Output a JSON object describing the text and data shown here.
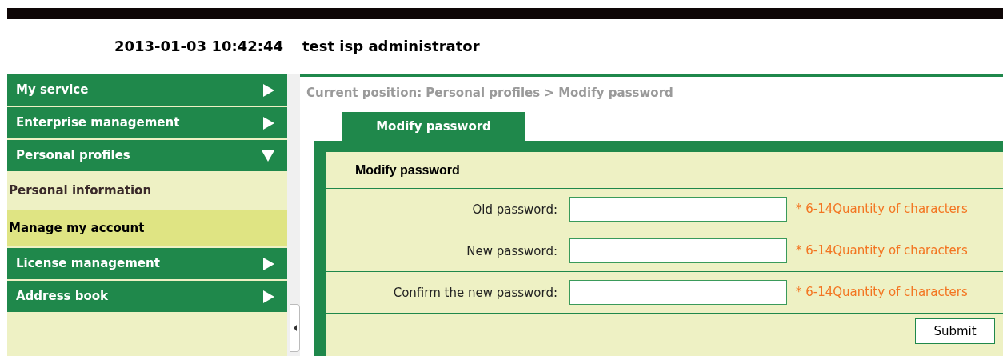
{
  "header": {
    "datetime": "2013-01-03 10:42:44",
    "user": "test isp administrator"
  },
  "sidebar": {
    "items": [
      {
        "label": "My service",
        "expanded": false
      },
      {
        "label": "Enterprise management",
        "expanded": false
      },
      {
        "label": "Personal profiles",
        "expanded": true,
        "children": [
          {
            "label": "Personal information",
            "selected": false
          },
          {
            "label": "Manage my account",
            "selected": true
          }
        ]
      },
      {
        "label": "License management",
        "expanded": false
      },
      {
        "label": "Address book",
        "expanded": false
      }
    ]
  },
  "breadcrumb": "Current position: Personal profiles > Modify password",
  "tabs": [
    {
      "label": "Modify password",
      "selected": true
    }
  ],
  "form": {
    "title": "Modify password",
    "fields": [
      {
        "label": "Old password:",
        "hint": "* 6-14Quantity of characters"
      },
      {
        "label": "New password:",
        "hint": "* 6-14Quantity of characters"
      },
      {
        "label": "Confirm the new password:",
        "hint": "* 6-14Quantity of characters"
      }
    ],
    "submit": "Submit"
  }
}
